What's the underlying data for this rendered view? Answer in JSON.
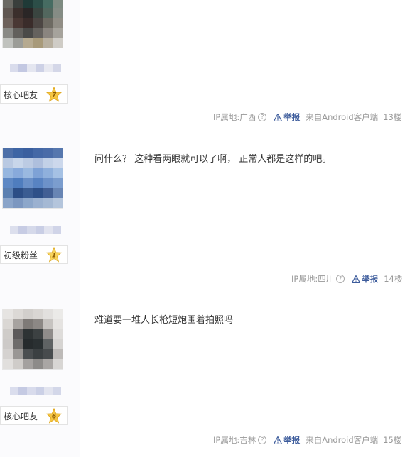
{
  "posts": [
    {
      "badge": "核心吧友",
      "level": "7",
      "content": "",
      "footer": {
        "location": "IP属地:广西",
        "report": "举报",
        "via": "来自Android客户端",
        "floor": "13楼"
      }
    },
    {
      "badge": "初级粉丝",
      "level": "1",
      "content": "问什么？ 这种看两眼就可以了啊， 正常人都是这样的吧。",
      "footer": {
        "location": "IP属地:四川",
        "report": "举报",
        "via": "",
        "floor": "14楼"
      }
    },
    {
      "badge": "核心吧友",
      "level": "6",
      "content": "难道要一堆人长枪短炮围着拍照吗",
      "footer": {
        "location": "IP属地:吉林",
        "report": "举报",
        "via": "来自Android客户端",
        "floor": "15楼"
      }
    }
  ],
  "colors": {
    "accent": "#3d5c9c",
    "meta": "#999999",
    "star": "#f5c542"
  },
  "icons": {
    "help": "question-circle-icon",
    "report": "warning-triangle-icon",
    "level": "star-icon"
  }
}
